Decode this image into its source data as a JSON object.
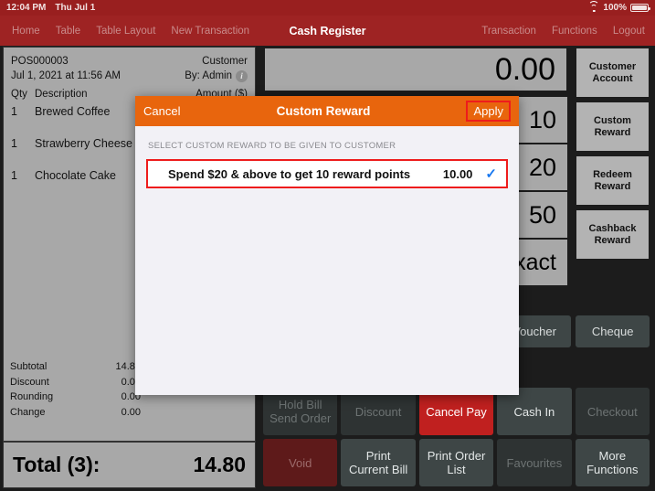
{
  "statusbar": {
    "time": "12:04 PM",
    "date": "Thu Jul 1",
    "wifi_icon": "wifi-icon",
    "battery_percent": "100%",
    "battery_icon": "battery-icon"
  },
  "nav": {
    "left_items": [
      "Home",
      "Table",
      "Table Layout",
      "New Transaction"
    ],
    "title": "Cash Register",
    "right_items": [
      "Transaction",
      "Functions",
      "Logout"
    ]
  },
  "receipt": {
    "order_no": "POS000003",
    "datetime": "Jul 1, 2021 at 11:56 AM",
    "customer_label": "Customer",
    "by_label": "By: Admin",
    "info_icon": "info-icon",
    "col_qty": "Qty",
    "col_desc": "Description",
    "col_amount": "Amount ($)",
    "items": [
      {
        "qty": "1",
        "desc": "Brewed Coffee"
      },
      {
        "qty": "1",
        "desc": "Strawberry Cheese"
      },
      {
        "qty": "1",
        "desc": "Chocolate Cake"
      }
    ]
  },
  "totals": {
    "lines": [
      {
        "label": "Subtotal",
        "value": "14.80"
      },
      {
        "label": "Discount",
        "value": "0.00"
      },
      {
        "label": "Rounding",
        "value": "0.00"
      },
      {
        "label": "Change",
        "value": "0.00"
      }
    ],
    "grand_label": "Total (3):",
    "grand_value": "14.80"
  },
  "display": {
    "amount": "0.00"
  },
  "keypad": {
    "keys": [
      "10",
      "20",
      "50",
      "Exact"
    ]
  },
  "right_buttons": [
    "Customer\nAccount",
    "Custom\nReward",
    "Redeem\nReward",
    "Cashback\nReward"
  ],
  "payment_row": {
    "voucher": "Voucher",
    "cheque": "Cheque"
  },
  "actions": [
    {
      "label": "Hold Bill\nSend Order",
      "style": "dim"
    },
    {
      "label": "Discount",
      "style": "dim"
    },
    {
      "label": "Cancel Pay",
      "style": "danger"
    },
    {
      "label": "Cash In",
      "style": "normal"
    },
    {
      "label": "Checkout",
      "style": "dim"
    },
    {
      "label": "Void",
      "style": "void"
    },
    {
      "label": "Print\nCurrent Bill",
      "style": "normal"
    },
    {
      "label": "Print Order\nList",
      "style": "normal"
    },
    {
      "label": "Favourites",
      "style": "dim"
    },
    {
      "label": "More\nFunctions",
      "style": "normal"
    }
  ],
  "modal": {
    "cancel": "Cancel",
    "title": "Custom Reward",
    "apply": "Apply",
    "caption": "SELECT CUSTOM REWARD TO BE GIVEN TO CUSTOMER",
    "reward": {
      "name": "Spend $20 & above to get 10 reward points",
      "value": "10.00",
      "check_icon": "checkmark-icon",
      "checked": true
    }
  },
  "colors": {
    "nav_red": "#9e2323",
    "status_red": "#991f1f",
    "accent_orange": "#e8650d",
    "highlight_red": "#ee1c1c",
    "check_blue": "#1878f0",
    "danger_red": "#c0201f"
  }
}
